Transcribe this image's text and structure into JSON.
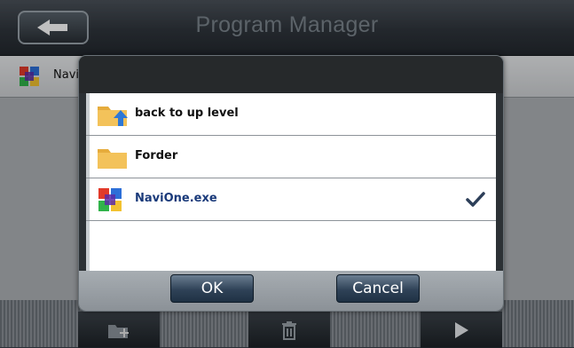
{
  "header": {
    "title": "Program Manager",
    "back_icon": "arrow-left-icon"
  },
  "background_list": {
    "item_label": "Navi",
    "item_icon": "navione-app-icon"
  },
  "toolbar": {
    "buttons": [
      {
        "icon": "folder-add-icon"
      },
      {
        "icon": "trash-icon"
      },
      {
        "icon": "play-icon"
      }
    ]
  },
  "dialog": {
    "items": [
      {
        "label": "back to up level",
        "icon": "folder-up-icon",
        "selected": false
      },
      {
        "label": "Forder",
        "icon": "folder-icon",
        "selected": false
      },
      {
        "label": "NaviOne.exe",
        "icon": "navione-app-icon",
        "selected": true
      }
    ],
    "check_icon": "checkmark-icon",
    "ok_label": "OK",
    "cancel_label": "Cancel"
  },
  "colors": {
    "selected_text": "#1a3a7a",
    "dialog_button": "#2f4257"
  }
}
